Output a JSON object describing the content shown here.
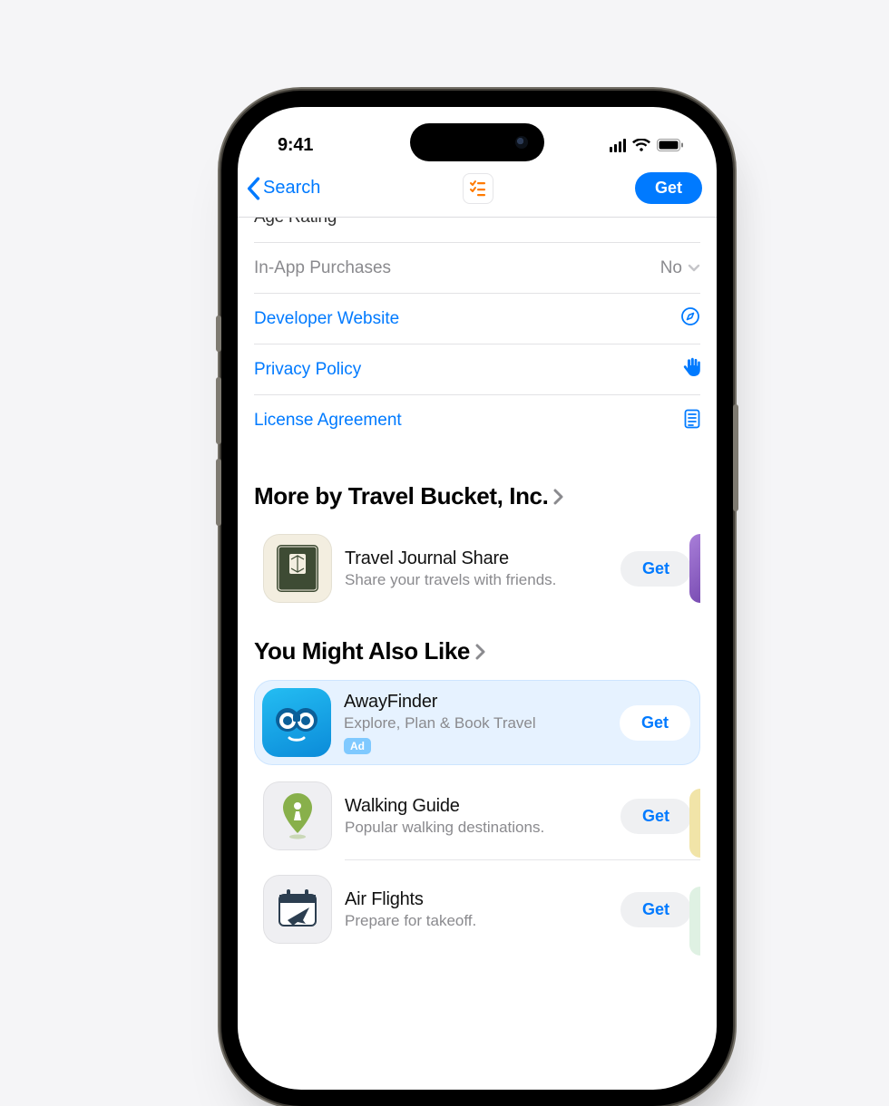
{
  "status": {
    "time": "9:41"
  },
  "nav": {
    "back": "Search",
    "get": "Get"
  },
  "info": {
    "cutoff_label": "Age Rating",
    "iap_label": "In-App Purchases",
    "iap_value": "No",
    "dev_website": "Developer Website",
    "privacy_policy": "Privacy Policy",
    "license": "License Agreement"
  },
  "sections": {
    "more_by": "More by Travel Bucket, Inc.",
    "you_might": "You Might Also Like"
  },
  "apps": {
    "travel_journal": {
      "name": "Travel Journal Share",
      "sub": "Share your travels with friends.",
      "get": "Get"
    },
    "awayfinder": {
      "name": "AwayFinder",
      "sub": "Explore, Plan & Book Travel",
      "ad": "Ad",
      "get": "Get"
    },
    "walking": {
      "name": "Walking Guide",
      "sub": "Popular walking destinations.",
      "get": "Get"
    },
    "flights": {
      "name": "Air Flights",
      "sub": "Prepare for takeoff.",
      "get": "Get"
    }
  }
}
